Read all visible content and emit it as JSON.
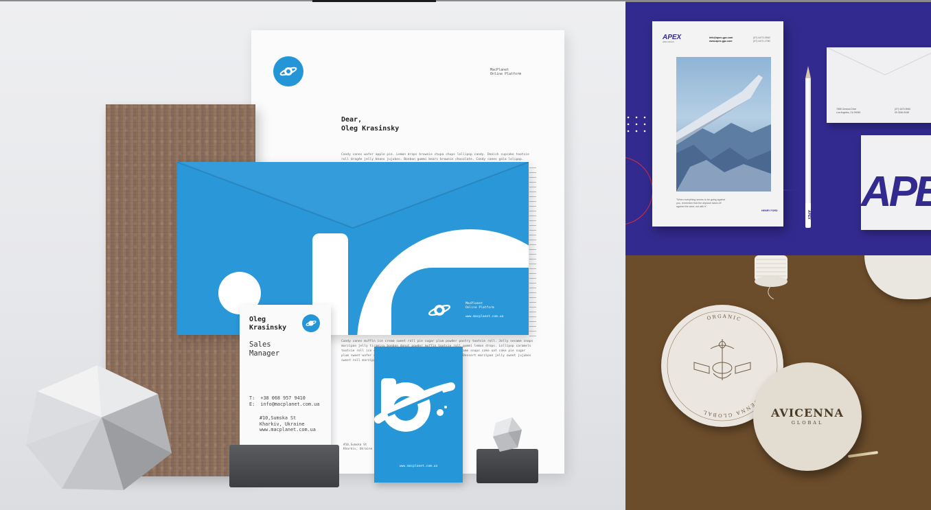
{
  "macplanet": {
    "company": "MacPlanet\nOnline Platform",
    "greeting": "Dear,\nOleg Krasinsky",
    "body_para1": "Candy canes wafer apple pie. Lemon drops brownie chupa chups lollipop candy. Danish cupcake tootsie roll dragée jelly beans jujubes. Bonbon gummi bears brownie chocolate. Candy canes gala lolipop.",
    "body_para2": "Candy canes muffin ice cream sweet roll pie sugar plum powder pastry tootsie roll. Jelly sesame snaps marzipan jelly tiramisu bonbon donut powder muffin tootsie roll gummi lemon drops. Lollipop caramels tootsie roll ice cream. Lollipop dragée jujubes dragée. Tart sesame snaps cake oat cake pie sugar plum sweet wafer sweet roll cotton candy pie cotton candy tart. Dessert marzipan jelly sweet jujubes sweet roll marzipan lemon drops.",
    "envelope_company": "MacPlanet\nOnline Platform",
    "envelope_url": "www.macplanet.com.ua",
    "card_name": "Oleg\nKrasinsky",
    "card_role": "Sales\nManager",
    "card_contact": "T:  +38 068 957 9410\nE:  info@macplanet.com.ua",
    "card_address": "#10,Sumska St\nKharkiv, Ukraine\nwww.macplanet.com.ua",
    "card_back_url": "www.macplanet.com.ua",
    "peek_address": "#10,Sumska St\nKharkiv, Ukraine",
    "brand_color": "#2496d8"
  },
  "apex": {
    "logo": "APEX",
    "logo_sub": "APEX GROUP",
    "contact": "info@apex-gpc.com\nwww.apex-gpc.com",
    "phone": "(07) 4473-9940\n(07) 4472-1780",
    "quote": "\"When everything seems to be going against\nyou, remember that the airplane takes off\nagainst the wind, not with it\"",
    "signature": "HENRY FORD",
    "pencil_label": "APEX",
    "envelope_address": "7808 Geneva Drive\nLos Angeles, CA 90045",
    "envelope_phone": "(07) 4473-9940\n09 3246-9448",
    "card_text": "APEX",
    "brand_color": "#322a8e"
  },
  "avicenna": {
    "title": "AVICENNA",
    "subtitle": "GLOBAL",
    "ring_text": "AVICENNA GLOBAL",
    "ring_text_bottom": "ORGANIC"
  }
}
